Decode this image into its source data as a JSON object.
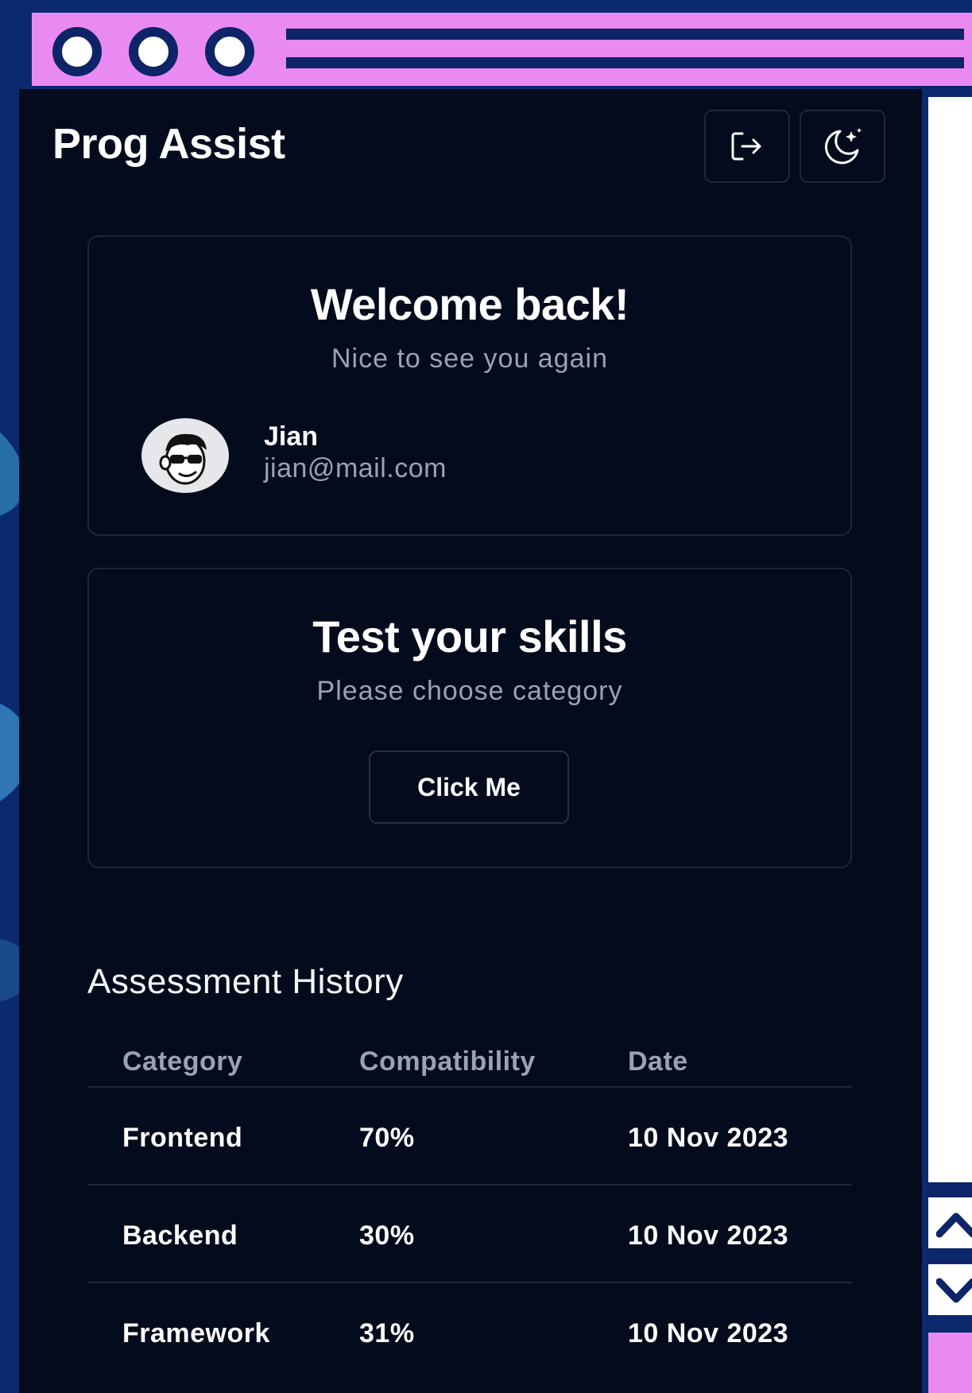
{
  "app": {
    "title": "Prog Assist"
  },
  "header_buttons": {
    "logout_icon": "logout-icon",
    "theme_icon": "moon-stars-icon"
  },
  "welcome_card": {
    "title": "Welcome back!",
    "subtitle": "Nice to see you again",
    "user": {
      "name": "Jian",
      "email": "jian@mail.com",
      "avatar_icon": "avatar-face-sunglasses"
    }
  },
  "skills_card": {
    "title": "Test your skills",
    "subtitle": "Please choose category",
    "button_label": "Click Me"
  },
  "history": {
    "title": "Assessment History",
    "columns": [
      "Category",
      "Compatibility",
      "Date"
    ],
    "rows": [
      {
        "category": "Frontend",
        "compatibility": "70%",
        "date": "10 Nov 2023"
      },
      {
        "category": "Backend",
        "compatibility": "30%",
        "date": "10 Nov 2023"
      },
      {
        "category": "Framework",
        "compatibility": "31%",
        "date": "10 Nov 2023"
      }
    ]
  },
  "colors": {
    "window_bg": "#0b2a6e",
    "titlebar": "#e98af3",
    "panel_bg": "#030b1c",
    "muted_text": "#9aa3b2"
  }
}
